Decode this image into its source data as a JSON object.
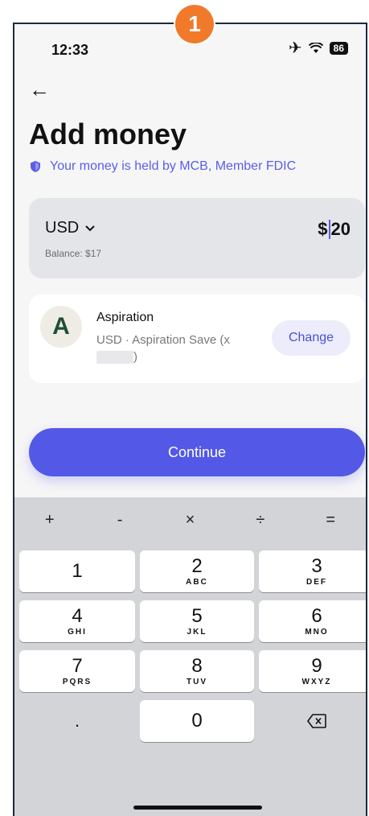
{
  "annotation": {
    "step": "1",
    "color": "#f07a2a"
  },
  "status_bar": {
    "time": "12:33",
    "airplane_icon": "airplane-icon",
    "wifi_icon": "wifi-icon",
    "battery": "86"
  },
  "header": {
    "back_icon": "back-arrow-icon",
    "title": "Add money"
  },
  "notice": {
    "icon": "shield-icon",
    "text": "Your money is held by MCB, Member FDIC"
  },
  "amount_card": {
    "currency": "USD",
    "dropdown_icon": "chevron-down-icon",
    "balance": "Balance: $17",
    "amount_prefix": "$",
    "amount_value": "20"
  },
  "account": {
    "logo_letter": "A",
    "name": "Aspiration",
    "detail": "USD · Aspiration Save",
    "masked_prefix": "(x",
    "masked_suffix": ")",
    "change_label": "Change"
  },
  "continue_label": "Continue",
  "keyboard": {
    "operators": [
      "+",
      "-",
      "×",
      "÷",
      "="
    ],
    "keys": [
      {
        "num": "1",
        "letters": ""
      },
      {
        "num": "2",
        "letters": "ABC"
      },
      {
        "num": "3",
        "letters": "DEF"
      },
      {
        "num": "4",
        "letters": "GHI"
      },
      {
        "num": "5",
        "letters": "JKL"
      },
      {
        "num": "6",
        "letters": "MNO"
      },
      {
        "num": "7",
        "letters": "PQRS"
      },
      {
        "num": "8",
        "letters": "TUV"
      },
      {
        "num": "9",
        "letters": "WXYZ"
      }
    ],
    "dot": ".",
    "zero": "0",
    "backspace_icon": "backspace-icon"
  },
  "colors": {
    "accent": "#5358e6",
    "accent_text": "#5a5ee8",
    "background": "#f6f6f7",
    "card": "#e4e5e9",
    "keyboard": "#d3d4d8"
  }
}
